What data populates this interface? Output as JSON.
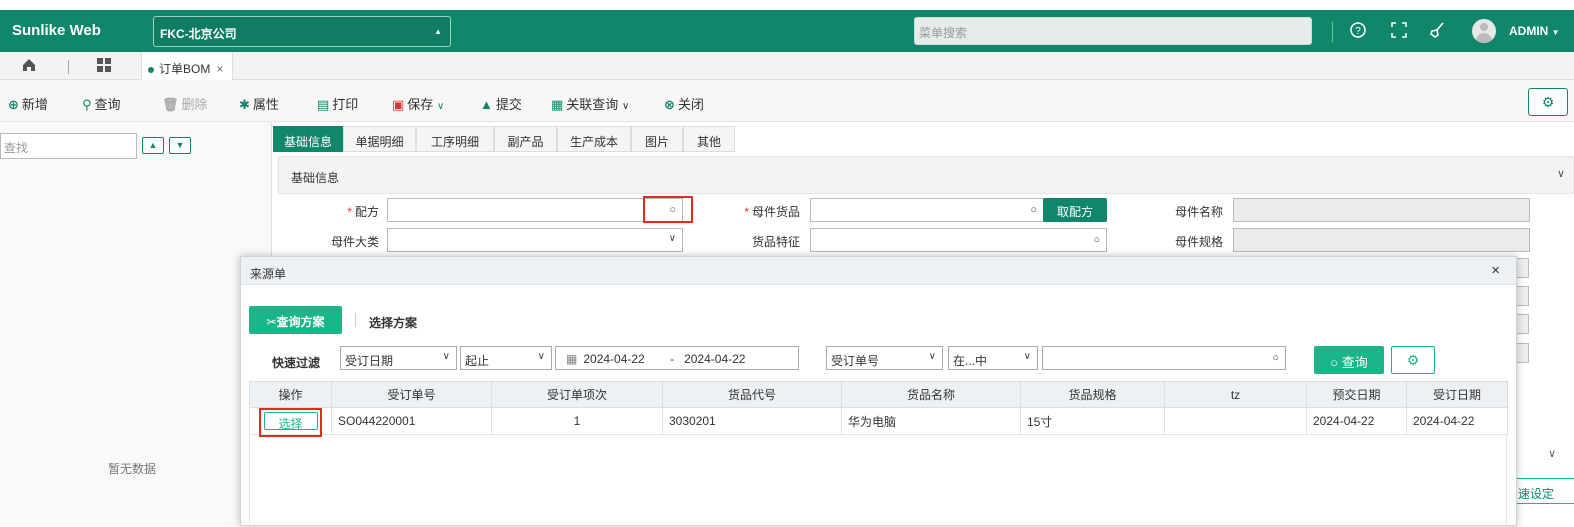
{
  "topbar": {
    "brand": "Sunlike Web",
    "company": "FKC-北京公司",
    "menu_search_placeholder": "菜单搜索",
    "user": "ADMIN"
  },
  "tabs": {
    "doc_tab": "订单BOM",
    "close": "×"
  },
  "toolbar": {
    "new": "新增",
    "query": "查询",
    "delete": "删除",
    "props": "属性",
    "print": "打印",
    "save": "保存",
    "submit": "提交",
    "related": "关联查询",
    "close": "关闭"
  },
  "left": {
    "find_placeholder": "查找",
    "no_data": "暂无数据"
  },
  "detail_tabs": [
    "基础信息",
    "单据明细",
    "工序明细",
    "副产品",
    "生产成本",
    "图片",
    "其他"
  ],
  "section": {
    "title": "基础信息"
  },
  "form": {
    "formula_label": "配方",
    "parent_goods_label": "母件货品",
    "fetch_formula_btn": "取配方",
    "parent_name_label": "母件名称",
    "parent_category_label": "母件大类",
    "goods_feature_label": "货品特征",
    "parent_spec_label": "母件规格"
  },
  "dialog": {
    "title": "来源单",
    "close": "×",
    "query_plan": "查询方案",
    "select_plan": "选择方案",
    "quick_filter": "快速过滤",
    "filter_field": "受订日期",
    "filter_op": "起止",
    "date_from": "2024-04-22",
    "date_sep": "-",
    "date_to": "2024-04-22",
    "field2": "受订单号",
    "op2": "在...中",
    "value2": "",
    "query_btn": "查询",
    "columns": [
      "操作",
      "受订单号",
      "受订单项次",
      "货品代号",
      "货品名称",
      "货品规格",
      "tz",
      "预交日期",
      "受订日期"
    ],
    "rows": [
      {
        "action": "选择",
        "order_no": "SO044220001",
        "item_no": "1",
        "goods_code": "3030201",
        "goods_name": "华为电脑",
        "goods_spec": "15寸",
        "tz": "",
        "delivery_date": "2024-04-22",
        "order_date": "2024-04-22"
      }
    ]
  },
  "right_partial_btn": "速设定",
  "colors": {
    "brand": "#10866a",
    "accent": "#1bb58a",
    "highlight": "#e02b20"
  }
}
